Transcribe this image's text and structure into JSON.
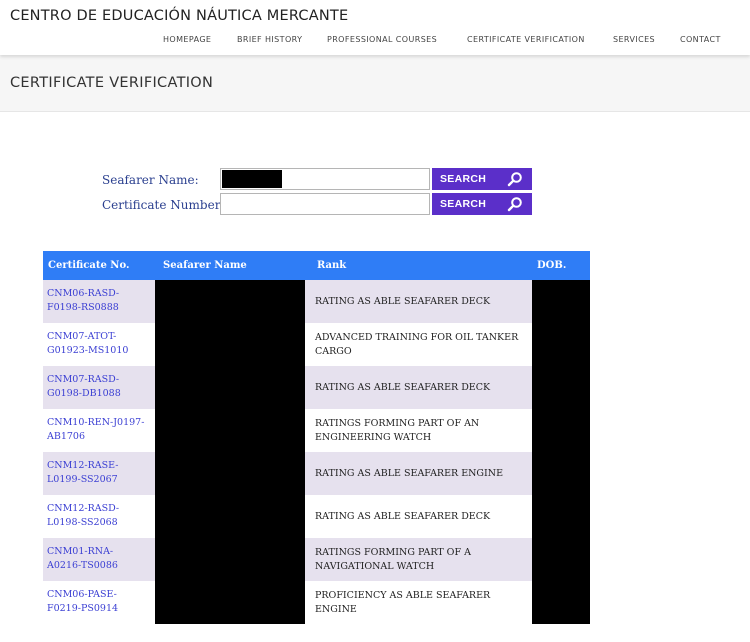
{
  "site": {
    "title": "CENTRO DE EDUCACIÓN NÁUTICA MERCANTE"
  },
  "nav": {
    "items": [
      {
        "label": "HOMEPAGE"
      },
      {
        "label": "BRIEF HISTORY"
      },
      {
        "label": "PROFESSIONAL COURSES"
      },
      {
        "label": "CERTIFICATE VERIFICATION"
      },
      {
        "label": "SERVICES"
      },
      {
        "label": "CONTACT"
      }
    ]
  },
  "page": {
    "title": "CERTIFICATE VERIFICATION"
  },
  "search": {
    "name_label": "Seafarer Name:",
    "name_value": "",
    "number_label": "Certificate Number:",
    "number_value": "",
    "button_label": "SEARCH",
    "button_color": "#5b2fc9"
  },
  "table": {
    "header_color": "#2f7df6",
    "columns": [
      "Certificate No.",
      "Seafarer Name",
      "Rank",
      "DOB."
    ],
    "rows": [
      {
        "cert_no": "CNM06-RASD-F0198-RS0888",
        "rank": "RATING AS ABLE SEAFARER DECK"
      },
      {
        "cert_no": "CNM07-ATOT-G01923-MS1010",
        "rank": "ADVANCED TRAINING FOR OIL TANKER CARGO"
      },
      {
        "cert_no": "CNM07-RASD-G0198-DB1088",
        "rank": "RATING AS ABLE SEAFARER DECK"
      },
      {
        "cert_no": "CNM10-REN-J0197-AB1706",
        "rank": "RATINGS FORMING PART OF AN ENGINEERING WATCH"
      },
      {
        "cert_no": "CNM12-RASE-L0199-SS2067",
        "rank": "RATING AS ABLE SEAFARER ENGINE"
      },
      {
        "cert_no": "CNM12-RASD-L0198-SS2068",
        "rank": "RATING AS ABLE SEAFARER DECK"
      },
      {
        "cert_no": "CNM01-RNA-A0216-TS0086",
        "rank": "RATINGS FORMING PART OF A NAVIGATIONAL WATCH"
      },
      {
        "cert_no": "CNM06-PASE-F0219-PS0914",
        "rank": "PROFICIENCY AS ABLE SEAFARER ENGINE"
      }
    ]
  }
}
